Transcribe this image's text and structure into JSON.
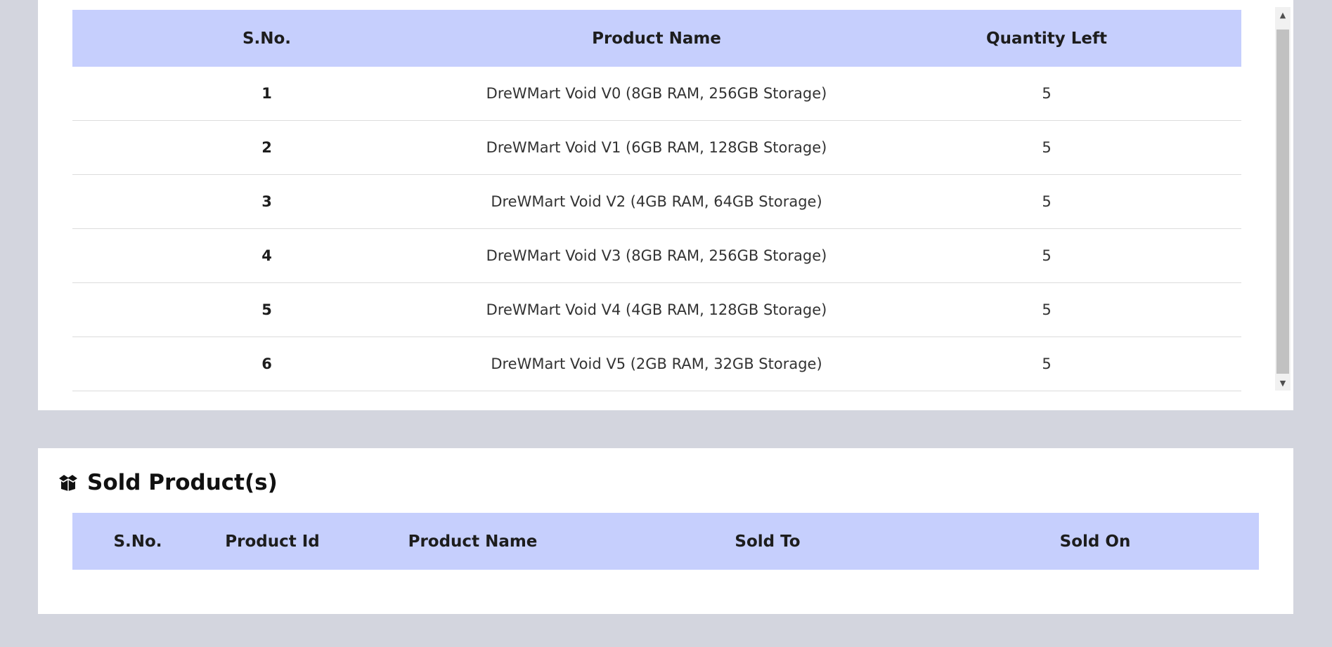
{
  "stock_table": {
    "headers": [
      "S.No.",
      "Product Name",
      "Quantity Left"
    ],
    "rows": [
      {
        "sno": "1",
        "name": "DreWMart Void V0 (8GB RAM, 256GB Storage)",
        "qty": "5"
      },
      {
        "sno": "2",
        "name": "DreWMart Void V1 (6GB RAM, 128GB Storage)",
        "qty": "5"
      },
      {
        "sno": "3",
        "name": "DreWMart Void V2 (4GB RAM, 64GB Storage)",
        "qty": "5"
      },
      {
        "sno": "4",
        "name": "DreWMart Void V3 (8GB RAM, 256GB Storage)",
        "qty": "5"
      },
      {
        "sno": "5",
        "name": "DreWMart Void V4 (4GB RAM, 128GB Storage)",
        "qty": "5"
      },
      {
        "sno": "6",
        "name": "DreWMart Void V5 (2GB RAM, 32GB Storage)",
        "qty": "5"
      }
    ]
  },
  "sold_section": {
    "icon": "box-open-icon",
    "title": "Sold Product(s)",
    "headers": [
      "S.No.",
      "Product Id",
      "Product Name",
      "Sold To",
      "Sold On"
    ],
    "rows": []
  },
  "colors": {
    "page_background": "#d3d5de",
    "panel_background": "#ffffff",
    "table_header": "#c6cffd",
    "row_divider": "#dcdcdc",
    "scrollbar_thumb": "#c1c1c1"
  }
}
